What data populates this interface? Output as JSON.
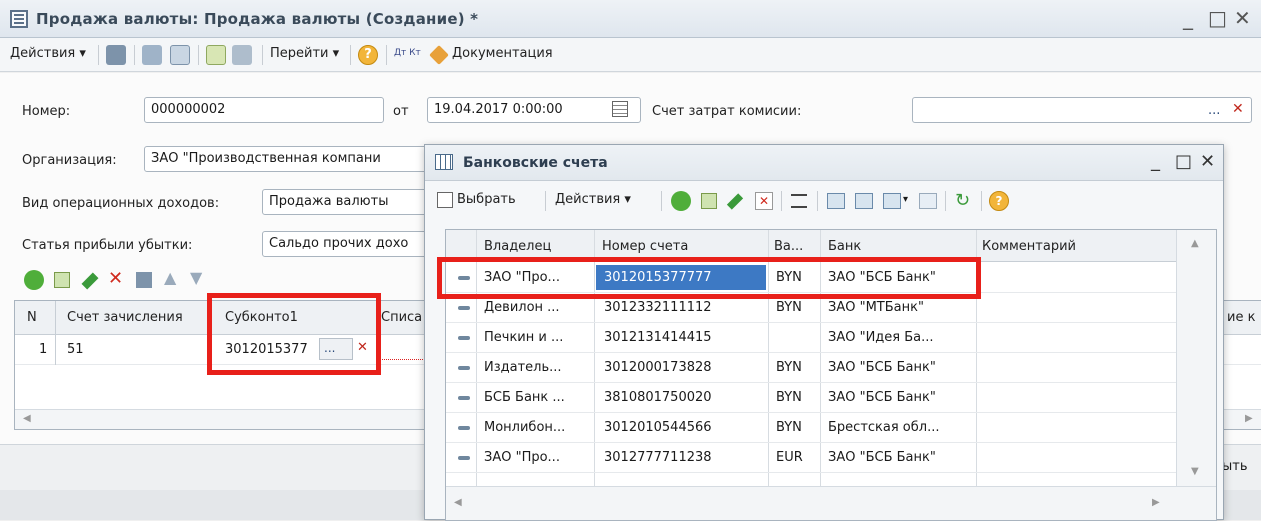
{
  "window": {
    "title": "Продажа валюты: Продажа валюты (Создание) *",
    "controls": [
      "_",
      "□",
      "✕"
    ]
  },
  "toolbar": {
    "actions_label": "Действия ▾",
    "goto_label": "Перейти ▾",
    "help": "?",
    "dt_kt": "Дт Кт",
    "docs_label": "Документация"
  },
  "form": {
    "number_label": "Номер:",
    "number_value": "000000002",
    "from_label": "от",
    "date_value": "19.04.2017  0:00:00",
    "commission_label": "Счет затрат комисии:",
    "commission_value": "",
    "org_label": "Организация:",
    "org_value": "ЗАО \"Производственная компани",
    "income_label": "Вид операционных доходов:",
    "income_value": "Продажа валюты",
    "profit_label": "Статья прибыли убытки:",
    "profit_value": "Сальдо прочих дохо"
  },
  "grid": {
    "columns": [
      "N",
      "Счет зачисления",
      "Субконто1",
      "Списа",
      "ие к"
    ],
    "rows": [
      {
        "n": "1",
        "account": "51",
        "subconto": "3012015377"
      }
    ],
    "subconto_buttons": [
      "...",
      "✕"
    ]
  },
  "bottom": {
    "close_partial": "ыть"
  },
  "popup": {
    "title": "Банковские счета",
    "controls": [
      "_",
      "□",
      "✕"
    ],
    "toolbar": {
      "select_label": "Выбрать",
      "actions_label": "Действия ▾"
    },
    "columns": [
      "Владелец",
      "Номер счета",
      "Ва...",
      "Банк",
      "Комментарий"
    ],
    "rows": [
      {
        "owner": "ЗАО \"Про...",
        "account": "3012015377777",
        "currency": "BYN",
        "bank": "ЗАО \"БСБ Банк\"",
        "comment": ""
      },
      {
        "owner": "Девилон ...",
        "account": "3012332111112",
        "currency": "BYN",
        "bank": "ЗАО \"МТБанк\"",
        "comment": ""
      },
      {
        "owner": "Печкин и ...",
        "account": "3012131414415",
        "currency": "",
        "bank": "ЗАО  \"Идея Ба...",
        "comment": ""
      },
      {
        "owner": "Издатель...",
        "account": "3012000173828",
        "currency": "BYN",
        "bank": "ЗАО \"БСБ Банк\"",
        "comment": ""
      },
      {
        "owner": "БСБ Банк ...",
        "account": "3810801750020",
        "currency": "BYN",
        "bank": "ЗАО \"БСБ Банк\"",
        "comment": ""
      },
      {
        "owner": "Монлибон...",
        "account": "3012010544566",
        "currency": "BYN",
        "bank": "Брестская обл...",
        "comment": ""
      },
      {
        "owner": "ЗАО \"Про...",
        "account": "3012777711238",
        "currency": "EUR",
        "bank": "ЗАО \"БСБ Банк\"",
        "comment": ""
      }
    ]
  },
  "colors": {
    "highlight_red": "#e8201a",
    "selection_blue": "#3d79c4",
    "title_text": "#3a4a5a"
  }
}
